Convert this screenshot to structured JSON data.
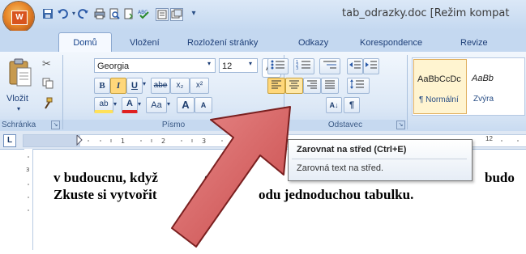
{
  "window": {
    "title": "tab_odrazky.doc [Režim kompat",
    "office_button": "Office",
    "office_logo": "W"
  },
  "quick_access": {
    "save": "💾",
    "undo": "↶",
    "redo": "↻",
    "print": "🖶",
    "preview": "🔍",
    "spell": "ABC",
    "more": "▾"
  },
  "tabs": [
    "Domů",
    "Vložení",
    "Rozložení stránky",
    "Odkazy",
    "Korespondence",
    "Revize"
  ],
  "ribbon": {
    "clipboard": {
      "paste_label": "Vložit",
      "group_label": "Schránka"
    },
    "font": {
      "font_name": "Georgia",
      "font_size": "12",
      "bold": "B",
      "italic": "I",
      "underline": "U",
      "strike": "abe",
      "subscript": "x₂",
      "superscript": "x²",
      "highlight": "ab",
      "color": "A",
      "case": "Aa",
      "grow": "A",
      "shrink": "A",
      "group_label": "Písmo"
    },
    "paragraph": {
      "sort": "A↓",
      "pilcrow": "¶",
      "group_label": "Odstavec"
    },
    "styles": {
      "style1_preview": "AaBbCcDc",
      "style1_name": "¶ Normální",
      "style2_preview": "AaBb",
      "style2_name": "Zvýra"
    }
  },
  "tooltip": {
    "title": "Zarovnat na střed (Ctrl+E)",
    "description": "Zarovná text na střed."
  },
  "document": {
    "lines": [
      "v budoucnu,  když",
      "e   n",
      "budo",
      "Zkuste si vytvořit",
      "odu jednoduchou tabulku."
    ]
  },
  "ruler": {
    "tick_label_right": "12"
  },
  "colors": {
    "accent": "#15428b",
    "arrow_fill": "#d45e5e",
    "highlight_yellow": "#ffe15a",
    "font_red": "#e02020"
  }
}
